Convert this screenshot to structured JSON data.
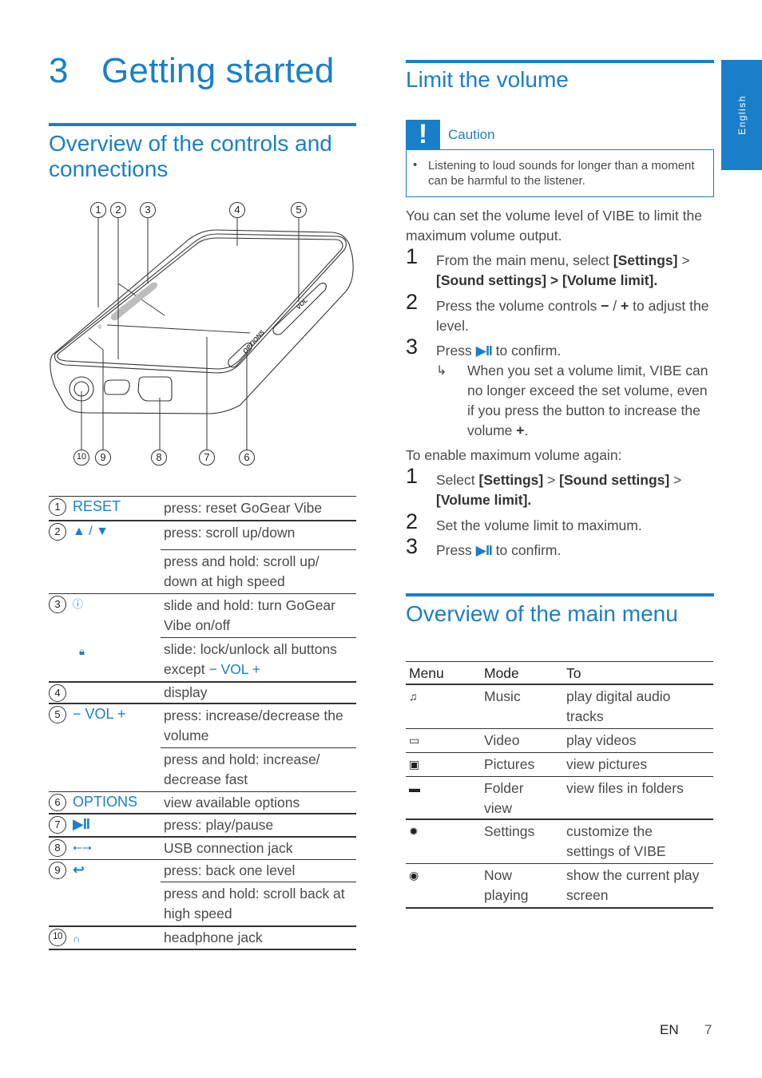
{
  "chapter": {
    "number": "3",
    "title": "Getting started"
  },
  "left": {
    "section_title": "Overview of the controls and connections",
    "figure": {
      "callouts_top": [
        "1",
        "2",
        "3",
        "4",
        "5"
      ],
      "callouts_bottom": [
        "10",
        "9",
        "8",
        "7",
        "6"
      ],
      "button_options_label": "OPTIONS",
      "button_vol_label": "VOL"
    },
    "controls": [
      {
        "num": "1",
        "label": "RESET",
        "icon": null,
        "rows": [
          "press: reset GoGear Vibe"
        ]
      },
      {
        "num": "2",
        "label": "▲ / ▼",
        "icon": "up-down-arrows",
        "rows": [
          "press: scroll up/down",
          "press and hold: scroll up/ down at high speed"
        ]
      },
      {
        "num": "3",
        "label": "ⓘ",
        "icon": "power-icon",
        "rows": [
          "slide and hold: turn GoGear Vibe on/off"
        ]
      },
      {
        "num": "",
        "label": "🔒",
        "icon": "lock-icon",
        "rows": [
          "slide: lock/unlock all buttons except"
        ],
        "rows_suffix": "− VOL +"
      },
      {
        "num": "4",
        "label": "",
        "icon": null,
        "rows": [
          "display"
        ]
      },
      {
        "num": "5",
        "label": "− VOL +",
        "icon": null,
        "rows": [
          "press: increase/decrease the volume",
          "press and hold: increase/ decrease fast"
        ]
      },
      {
        "num": "6",
        "label": "OPTIONS",
        "icon": null,
        "rows": [
          "view available options"
        ]
      },
      {
        "num": "7",
        "label": "▶II",
        "icon": "play-pause-icon",
        "rows": [
          "press: play/pause"
        ]
      },
      {
        "num": "8",
        "label": "⭠",
        "icon": "usb-icon",
        "rows": [
          "USB connection jack"
        ]
      },
      {
        "num": "9",
        "label": "↩",
        "icon": "back-icon",
        "rows": [
          "press: back one level",
          "press and hold: scroll back at high speed"
        ]
      },
      {
        "num": "10",
        "label": "",
        "icon": "headphone-icon",
        "rows": [
          "headphone jack"
        ]
      }
    ]
  },
  "right": {
    "limit_title": "Limit the volume",
    "caution": {
      "label": "Caution",
      "bullet": "Listening to loud sounds for longer than a moment can be harmful to the listener."
    },
    "intro": "You can set the volume level of VIBE to limit the maximum volume output.",
    "steps_a": [
      {
        "n": "1",
        "pre": "From the main menu, select ",
        "b1": "[Settings]",
        "mid": " > ",
        "b2": "[Sound settings] > [Volume limit]."
      },
      {
        "n": "2",
        "pre": "Press the volume controls ",
        "minus": "−",
        "slash": " / ",
        "plus": "+",
        "post": " to adjust the level."
      },
      {
        "n": "3",
        "pre": "Press ",
        "pp": "▶II",
        "post": " to confirm."
      }
    ],
    "result": {
      "pre": "When you set a volume limit, VIBE can no longer exceed the set volume, even if you press the button to increase the volume ",
      "plus": "+",
      "post": "."
    },
    "enable_intro": "To enable maximum volume again:",
    "steps_b": [
      {
        "n": "1",
        "pre": "Select ",
        "b1": "[Settings]",
        "mid": " > ",
        "b2": "[Sound settings]",
        "mid2": " > ",
        "b3": "[Volume limit]."
      },
      {
        "n": "2",
        "text": "Set the volume limit to maximum."
      },
      {
        "n": "3",
        "pre": "Press ",
        "pp": "▶II",
        "post": " to confirm."
      }
    ],
    "menu_title": "Overview of the main menu",
    "menu_table": {
      "headers": [
        "Menu",
        "Mode",
        "To"
      ],
      "rows": [
        {
          "icon": "♫",
          "icon_name": "music-icon",
          "mode": "Music",
          "to": "play digital audio tracks"
        },
        {
          "icon": "▭",
          "icon_name": "video-icon",
          "mode": "Video",
          "to": "play videos"
        },
        {
          "icon": "▣",
          "icon_name": "pictures-icon",
          "mode": "Pictures",
          "to": "view pictures"
        },
        {
          "icon": "▬",
          "icon_name": "folder-icon",
          "mode": "Folder view",
          "to": "view files in folders"
        },
        {
          "icon": "✹",
          "icon_name": "settings-icon",
          "mode": "Settings",
          "to": "customize the settings of VIBE"
        },
        {
          "icon": "◉",
          "icon_name": "now-playing-icon",
          "mode": "Now playing",
          "to": "show the current play screen"
        }
      ]
    }
  },
  "language_tab": "English",
  "footer": {
    "lang": "EN",
    "page": "7"
  }
}
